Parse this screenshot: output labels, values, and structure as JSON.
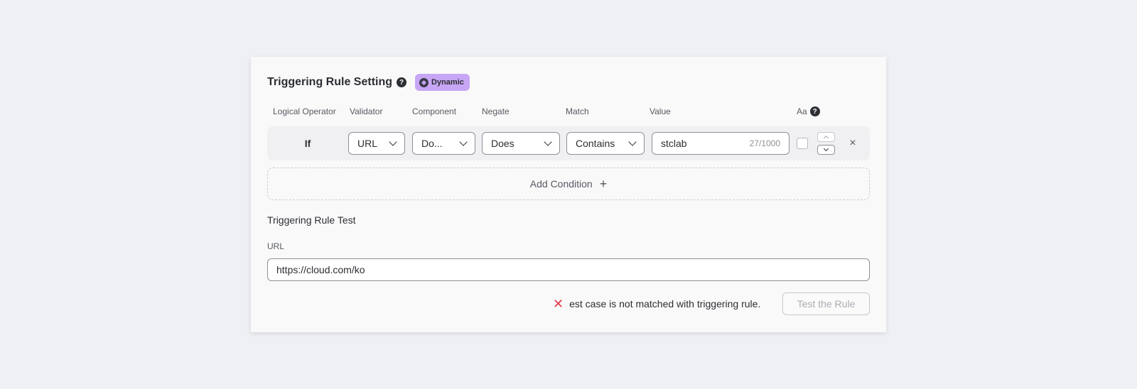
{
  "header": {
    "title": "Triggering Rule Setting",
    "help_glyph": "?",
    "badge_label": "Dynamic"
  },
  "columns": {
    "logical_operator": "Logical Operator",
    "validator": "Validator",
    "component": "Component",
    "negate": "Negate",
    "match": "Match",
    "value": "Value",
    "case": "Aa"
  },
  "condition": {
    "operator": "If",
    "validator": "URL",
    "component": "Do...",
    "negate": "Does",
    "match": "Contains",
    "value": "stclab",
    "value_count": "27/1000",
    "case_sensitive": false
  },
  "add_condition": {
    "label": "Add Condition",
    "icon": "+"
  },
  "test": {
    "title": "Triggering Rule Test",
    "url_label": "URL",
    "url_value": "https://cloud.com/ko",
    "result_icon": "✕",
    "result_message": "est case is not matched with triggering rule.",
    "button_label": "Test the Rule"
  },
  "colors": {
    "background": "#eef0f4",
    "card": "#f9f9f9",
    "badge": "#c7a6f5",
    "error": "#e03a4a"
  }
}
